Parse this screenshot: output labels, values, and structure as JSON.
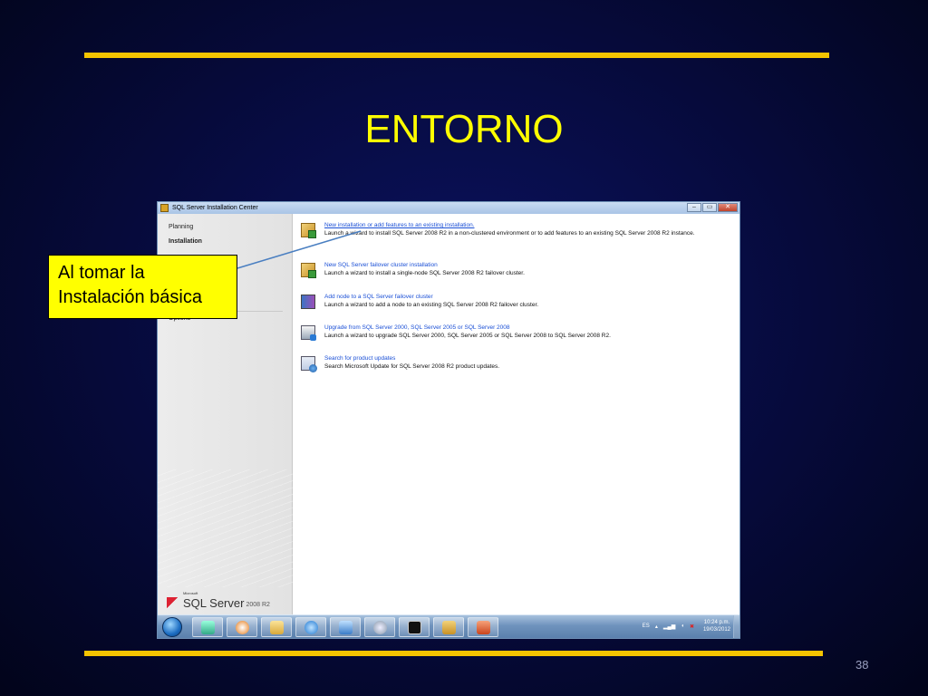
{
  "slide": {
    "title": "ENTORNO",
    "number": "38",
    "callout": "Al tomar la Instalación básica"
  },
  "window": {
    "title": "SQL Server Installation Center",
    "controls": {
      "minimize": "–",
      "maximize": "▭",
      "close": "✕"
    }
  },
  "sidebar": {
    "items": [
      "Planning",
      "Installation",
      "Options"
    ],
    "active": "Installation",
    "logo_small": "Microsoft",
    "logo_text": "SQL Server",
    "logo_version": "2008 R2"
  },
  "content": {
    "items": [
      {
        "icon": "package-icon",
        "link": "New installation or add features to an existing installation.",
        "desc": "Launch a wizard to install SQL Server 2008 R2 in a non-clustered environment or to add features to an existing SQL Server 2008 R2 instance."
      },
      {
        "icon": "package-icon",
        "link": "New SQL Server failover cluster installation",
        "desc": "Launch a wizard to install a single-node SQL Server 2008 R2 failover cluster."
      },
      {
        "icon": "cluster-node-icon",
        "link": "Add node to a SQL Server failover cluster",
        "desc": "Launch a wizard to add a node to an existing SQL Server 2008 R2 failover cluster."
      },
      {
        "icon": "upgrade-icon",
        "link": "Upgrade from SQL Server 2000, SQL Server 2005 or SQL Server 2008",
        "desc": "Launch a wizard to upgrade SQL Server 2000, SQL Server 2005 or SQL Server 2008 to SQL Server 2008 R2."
      },
      {
        "icon": "search-updates-icon",
        "link": "Search for product updates",
        "desc": "Search Microsoft Update for SQL Server 2008 R2 product updates."
      }
    ]
  },
  "taskbar": {
    "buttons": [
      "start-orb-icon",
      "network-icon",
      "media-player-icon",
      "folder-icon",
      "internet-explorer-icon",
      "control-panel-icon",
      "settings-icon",
      "command-prompt-icon",
      "sql-installer-icon",
      "powerpoint-icon"
    ],
    "language": "ES",
    "time": "10:24 p.m.",
    "date": "19/03/2012"
  },
  "colors": {
    "slide_bg": "#060a3a",
    "accent_bar": "#f5c400",
    "title": "#ffff00",
    "callout_bg": "#ffff00",
    "link": "#1a4fd6"
  }
}
